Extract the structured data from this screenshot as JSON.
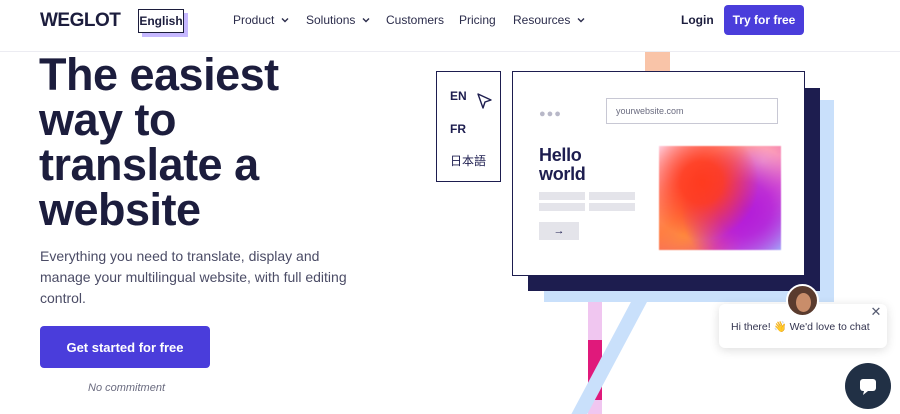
{
  "nav": {
    "logo": "WEGLOT",
    "language": "English",
    "items": [
      {
        "label": "Product",
        "has_dropdown": true
      },
      {
        "label": "Solutions",
        "has_dropdown": true
      },
      {
        "label": "Customers",
        "has_dropdown": false
      },
      {
        "label": "Pricing",
        "has_dropdown": false
      },
      {
        "label": "Resources",
        "has_dropdown": true
      }
    ],
    "login": "Login",
    "cta": "Try for free"
  },
  "hero": {
    "headline": "The easiest way to translate a website",
    "subtext": "Everything you need to translate, display and manage your multilingual website, with full editing control.",
    "cta": "Get started for free",
    "note": "No commitment"
  },
  "illustration": {
    "languages": [
      "EN",
      "FR",
      "日本語"
    ],
    "url_placeholder": "yourwebsite.com",
    "hello": "Hello world",
    "arrow": "→"
  },
  "chat": {
    "greeting": "Hi there! 👋 We'd love to chat",
    "close": "✕"
  },
  "colors": {
    "brand_purple": "#4a3ddb",
    "navy": "#1d1d4f",
    "light_blue": "#c9e0fb",
    "peach": "#f9c4a8",
    "magenta": "#e0197b"
  }
}
